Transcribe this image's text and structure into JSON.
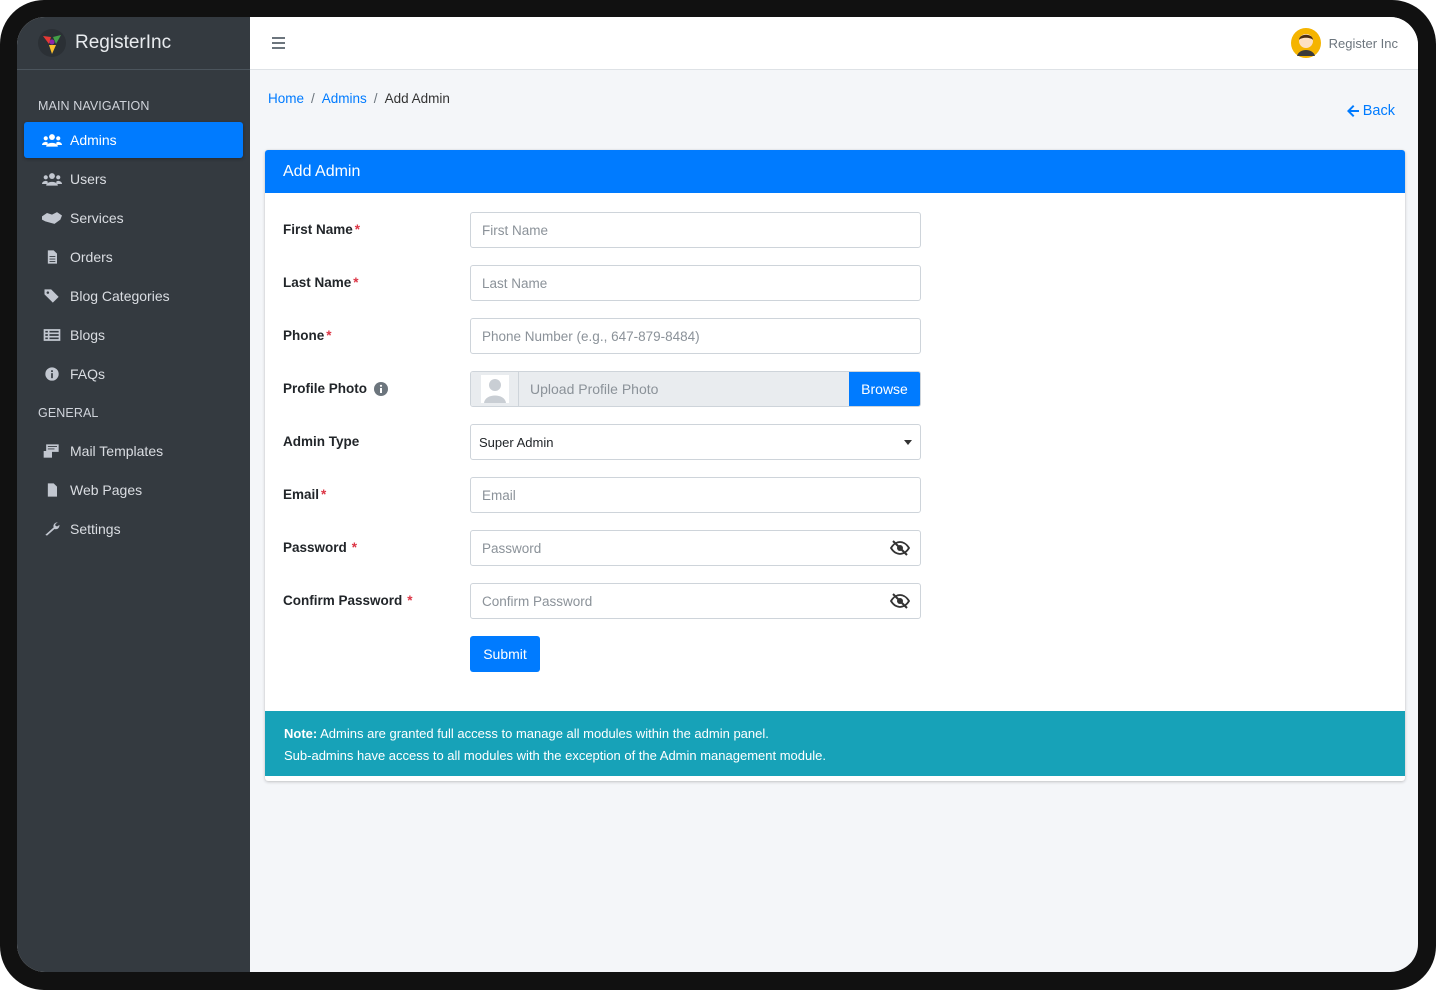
{
  "brand": {
    "name": "RegisterInc"
  },
  "sidebar": {
    "main_header": "MAIN NAVIGATION",
    "main_items": [
      {
        "label": "Admins",
        "icon": "users-icon",
        "active": true
      },
      {
        "label": "Users",
        "icon": "users-icon"
      },
      {
        "label": "Services",
        "icon": "handshake-icon"
      },
      {
        "label": "Orders",
        "icon": "file-icon"
      },
      {
        "label": "Blog Categories",
        "icon": "tag-icon"
      },
      {
        "label": "Blogs",
        "icon": "list-icon"
      },
      {
        "label": "FAQs",
        "icon": "info-icon"
      }
    ],
    "general_header": "GENERAL",
    "general_items": [
      {
        "label": "Mail Templates",
        "icon": "mail-templates-icon"
      },
      {
        "label": "Web Pages",
        "icon": "page-icon"
      },
      {
        "label": "Settings",
        "icon": "wrench-icon"
      }
    ]
  },
  "topbar": {
    "user_name": "Register Inc"
  },
  "breadcrumb": {
    "home": "Home",
    "admins": "Admins",
    "current": "Add Admin",
    "separator": "/"
  },
  "back_label": "Back",
  "card": {
    "title": "Add Admin"
  },
  "form": {
    "first_name": {
      "label": "First Name",
      "required": "*",
      "placeholder": "First Name"
    },
    "last_name": {
      "label": "Last Name",
      "required": "*",
      "placeholder": "Last Name"
    },
    "phone": {
      "label": "Phone",
      "required": "*",
      "placeholder": "Phone Number (e.g., 647-879-8484)"
    },
    "profile_photo": {
      "label": "Profile Photo",
      "upload_text": "Upload Profile Photo",
      "browse_label": "Browse"
    },
    "admin_type": {
      "label": "Admin Type",
      "selected": "Super Admin"
    },
    "email": {
      "label": "Email",
      "required": "*",
      "placeholder": "Email"
    },
    "password": {
      "label": "Password",
      "required": "*",
      "placeholder": "Password"
    },
    "confirm_password": {
      "label": "Confirm Password",
      "required": "*",
      "placeholder": "Confirm Password"
    },
    "submit_label": "Submit"
  },
  "note": {
    "prefix": "Note:",
    "line1": "Admins are granted full access to manage all modules within the admin panel.",
    "line2": "Sub-admins have access to all modules with the exception of the Admin management module."
  },
  "colors": {
    "primary": "#007bff",
    "sidebar_bg": "#343a40",
    "note_bg": "#17a2b8",
    "required": "#dc3545"
  }
}
